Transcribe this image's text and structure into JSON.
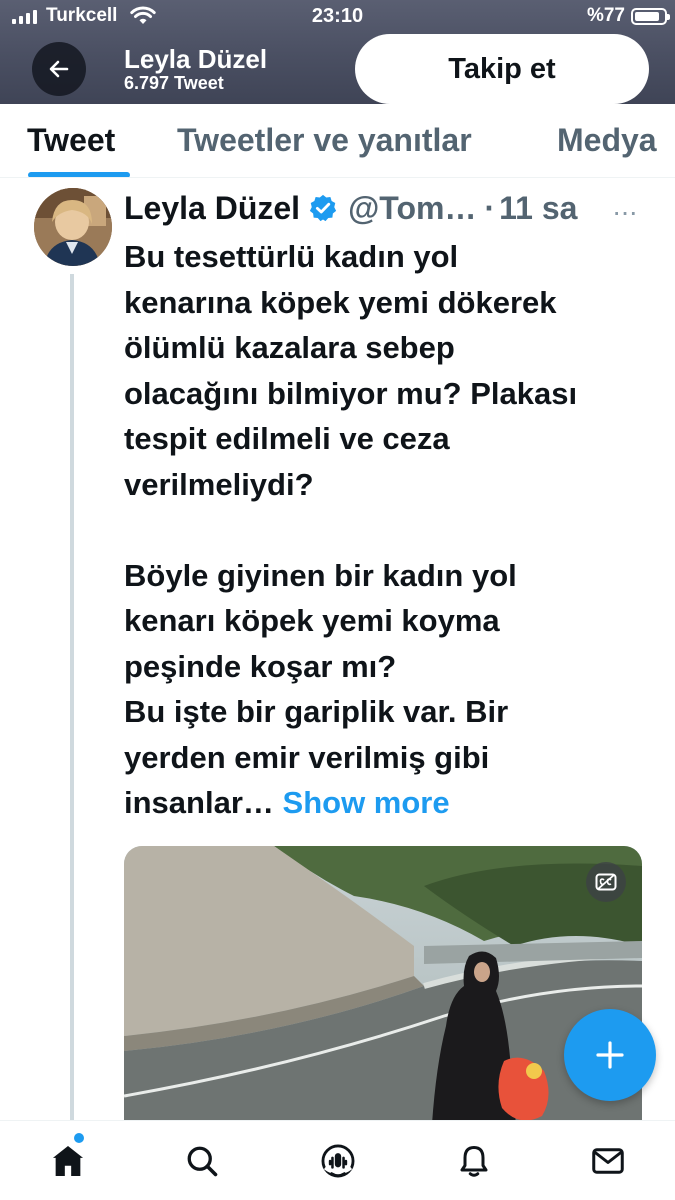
{
  "status_bar": {
    "carrier": "Turkcell",
    "time": "23:10",
    "battery": "%77"
  },
  "header": {
    "name": "Leyla Düzel",
    "tweet_count": "6.797 Tweet",
    "follow_label": "Takip et"
  },
  "tabs": [
    {
      "label": "Tweet",
      "active": true
    },
    {
      "label": "Tweetler ve yanıtlar",
      "active": false
    },
    {
      "label": "Medya",
      "active": false
    }
  ],
  "tweet": {
    "author": "Leyla Düzel",
    "handle": "@Tom…",
    "separator": "·",
    "time_ago": "11 sa",
    "more_glyph": "···",
    "lines_p1": [
      "Bu tesettürlü kadın yol",
      "kenarına köpek yemi dökerek",
      "ölümlü kazalara sebep",
      "olacağını bilmiyor mu? Plakası",
      "tespit edilmeli ve ceza",
      "verilmeliydi?"
    ],
    "lines_p2": [
      "Böyle giyinen bir kadın yol",
      "kenarı köpek yemi koyma",
      "peşinde koşar mı?",
      "Bu işte bir gariplik var. Bir",
      "yerden emir verilmiş gibi"
    ],
    "last_line": "insanlar…",
    "show_more": "Show more"
  },
  "icons": {
    "back": "arrow-left-icon",
    "verified": "verified-badge-icon",
    "media": "closed-captions-icon",
    "compose": "plus-icon",
    "nav": [
      "home-icon",
      "search-icon",
      "spaces-icon",
      "bell-icon",
      "mail-icon"
    ]
  },
  "colors": {
    "accent": "#1d9bf0",
    "header_bg": "#4a4f62",
    "muted_text": "#536471"
  }
}
